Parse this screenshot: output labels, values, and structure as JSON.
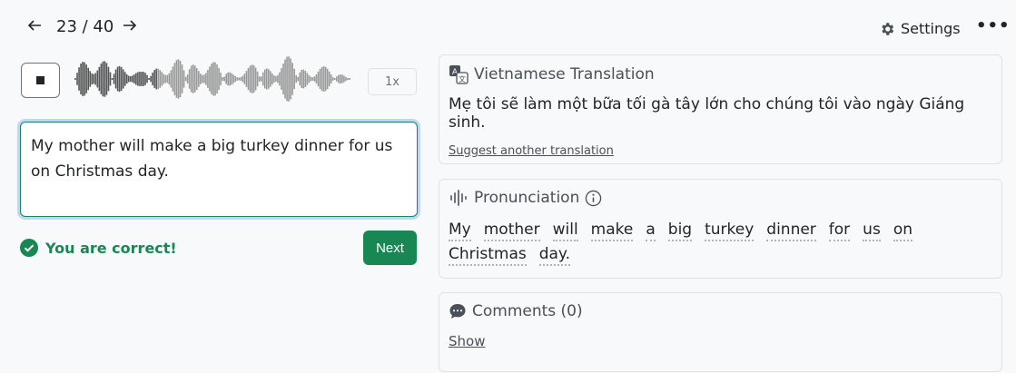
{
  "nav": {
    "prev_icon": "arrow-left-icon",
    "next_icon": "arrow-right-icon",
    "counter": "23 / 40"
  },
  "toolbar": {
    "settings_label": "Settings",
    "settings_icon": "gear-icon",
    "more_icon": "ellipsis-icon",
    "more_label": "•••"
  },
  "player": {
    "stop_icon": "stop-icon",
    "speed": "1x"
  },
  "answer": {
    "value": "My mother will make a big turkey dinner for us on Christmas day."
  },
  "result": {
    "text": "You are correct!",
    "color": "#198754"
  },
  "next_button": {
    "label": "Next"
  },
  "translation": {
    "title": "Vietnamese Translation",
    "text": "Mẹ tôi sẽ làm một bữa tối gà tây lớn cho chúng tôi vào ngày Giáng sinh.",
    "suggest_link": "Suggest another translation"
  },
  "pronunciation": {
    "title": "Pronunciation",
    "words": [
      "My",
      "mother",
      "will",
      "make",
      "a",
      "big",
      "turkey",
      "dinner",
      "for",
      "us",
      "on",
      "Christmas",
      "day."
    ]
  },
  "comments": {
    "title": "Comments (0)",
    "show_link": "Show"
  },
  "colors": {
    "accent": "#198754",
    "background": "#f8f9fa",
    "border": "#dee2e6"
  }
}
